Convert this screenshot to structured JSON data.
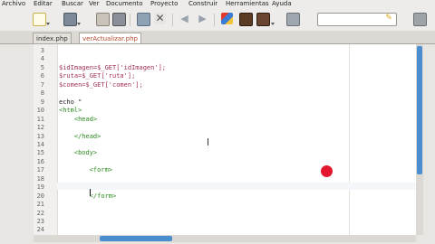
{
  "menu": [
    "Archivo",
    "Editar",
    "Buscar",
    "Ver",
    "Documento",
    "Proyecto",
    "Construir",
    "Herramientas",
    "Ayuda"
  ],
  "tabs": [
    {
      "label": "index.php"
    },
    {
      "label": "verActualizar.php",
      "active": true
    }
  ],
  "editor": {
    "lines": [
      {
        "n": "3",
        "t": ""
      },
      {
        "n": "4",
        "t": ""
      },
      {
        "n": "5",
        "t": "$idImagen=$_GET['idImagen'];"
      },
      {
        "n": "6",
        "t": "$ruta=$_GET['ruta'];"
      },
      {
        "n": "7",
        "t": "$comen=$_GET['comen'];"
      },
      {
        "n": "8",
        "t": ""
      },
      {
        "n": "9",
        "t": "echo \""
      },
      {
        "n": "10",
        "t": "<html>"
      },
      {
        "n": "11",
        "t": "    <head>"
      },
      {
        "n": "12",
        "t": ""
      },
      {
        "n": "13",
        "t": "    </head>"
      },
      {
        "n": "14",
        "t": ""
      },
      {
        "n": "15",
        "t": "    <body>"
      },
      {
        "n": "16",
        "t": ""
      },
      {
        "n": "17",
        "t": "        <form>"
      },
      {
        "n": "18",
        "t": ""
      },
      {
        "n": "19",
        "t": ""
      },
      {
        "n": "20",
        "t": "        </form>"
      },
      {
        "n": "21",
        "t": ""
      },
      {
        "n": "22",
        "t": ""
      },
      {
        "n": "23",
        "t": ""
      },
      {
        "n": "24",
        "t": ""
      }
    ]
  },
  "colors": {
    "php_var": "#a0305a",
    "html_tag": "#2a8a1e",
    "echo": "#222222",
    "scroll": "#4a8ed0"
  }
}
